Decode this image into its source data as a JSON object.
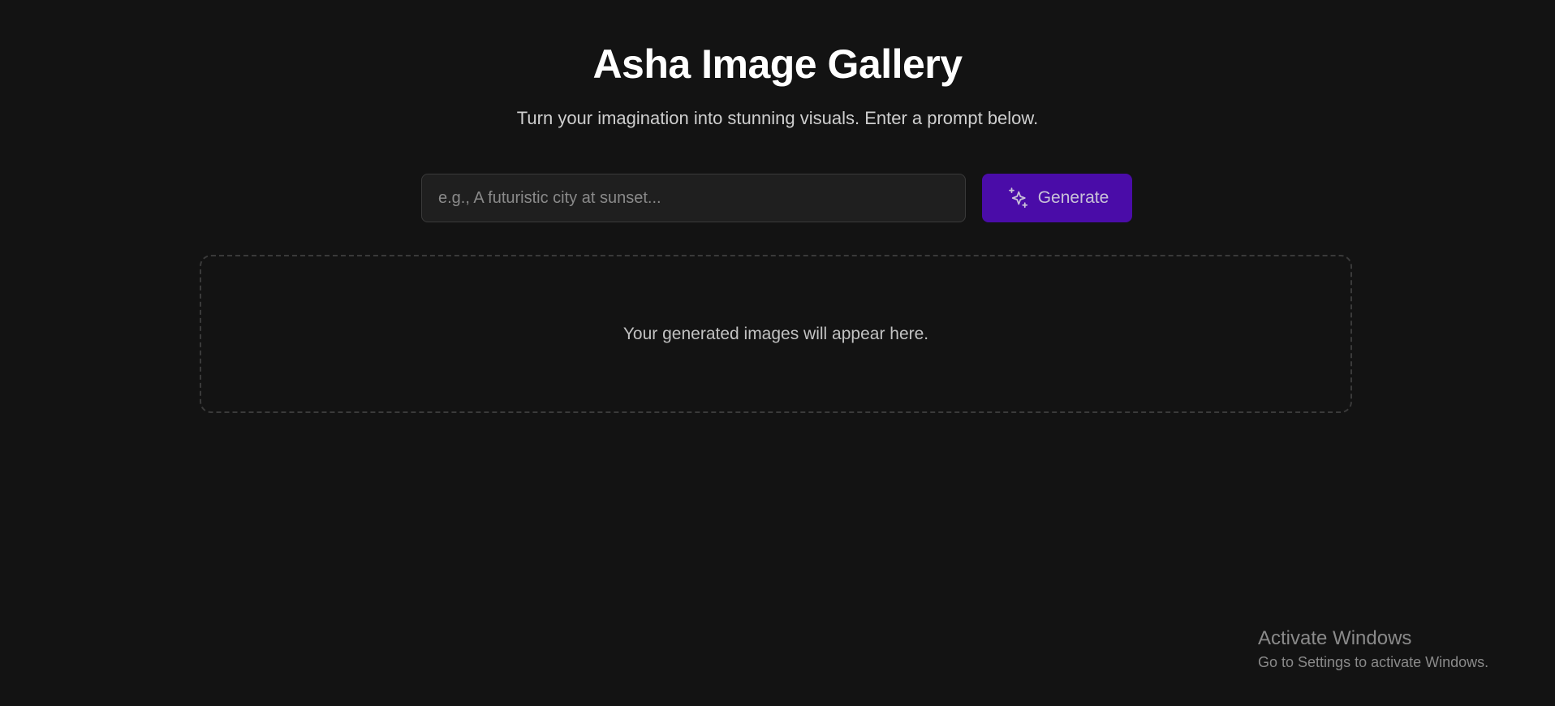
{
  "header": {
    "title": "Asha Image Gallery",
    "subtitle": "Turn your imagination into stunning visuals. Enter a prompt below."
  },
  "prompt": {
    "value": "",
    "placeholder": "e.g., A futuristic city at sunset...",
    "generate_label": "Generate",
    "generate_icon": "sparkles-icon"
  },
  "gallery": {
    "empty_message": "Your generated images will appear here."
  },
  "watermark": {
    "title": "Activate Windows",
    "subtitle": "Go to Settings to activate Windows."
  },
  "colors": {
    "background": "#131313",
    "accent": "#4a0ca8"
  }
}
